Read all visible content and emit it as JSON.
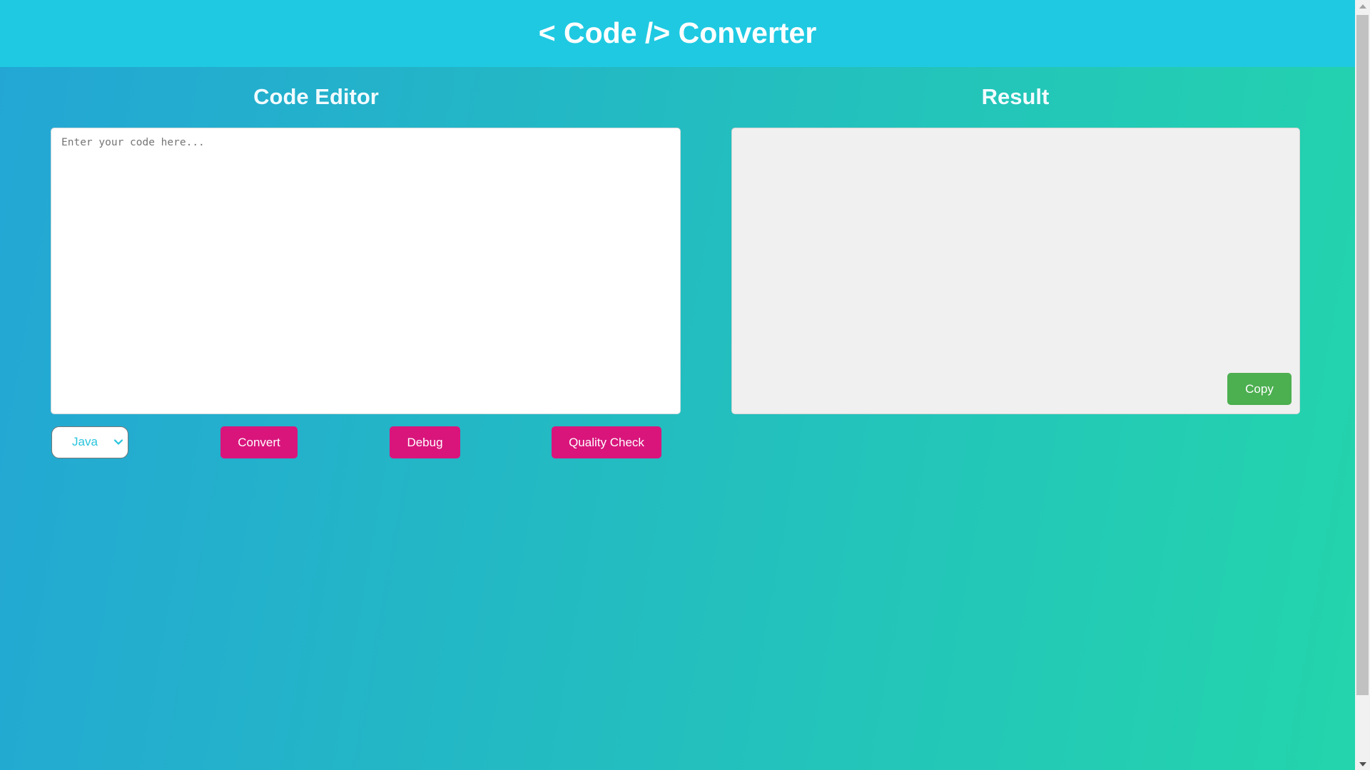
{
  "header": {
    "title": "< Code /> Converter"
  },
  "editor": {
    "title": "Code Editor",
    "value": "",
    "placeholder": "Enter your code here...",
    "language_select": {
      "selected": "Java",
      "icon": "chevron-down-icon"
    },
    "buttons": {
      "convert": "Convert",
      "debug": "Debug",
      "quality_check": "Quality Check"
    }
  },
  "result": {
    "title": "Result",
    "content": "",
    "copy_label": "Copy"
  },
  "colors": {
    "header_bg": "#1fc9e2",
    "gradient_start": "#23a6d5",
    "gradient_end": "#23d5ab",
    "action_button": "#d9157c",
    "copy_button": "#4caf50",
    "select_text": "#29c4dc"
  },
  "scrollbar": {
    "up_icon": "arrow-up-icon",
    "down_icon": "arrow-down-icon"
  }
}
